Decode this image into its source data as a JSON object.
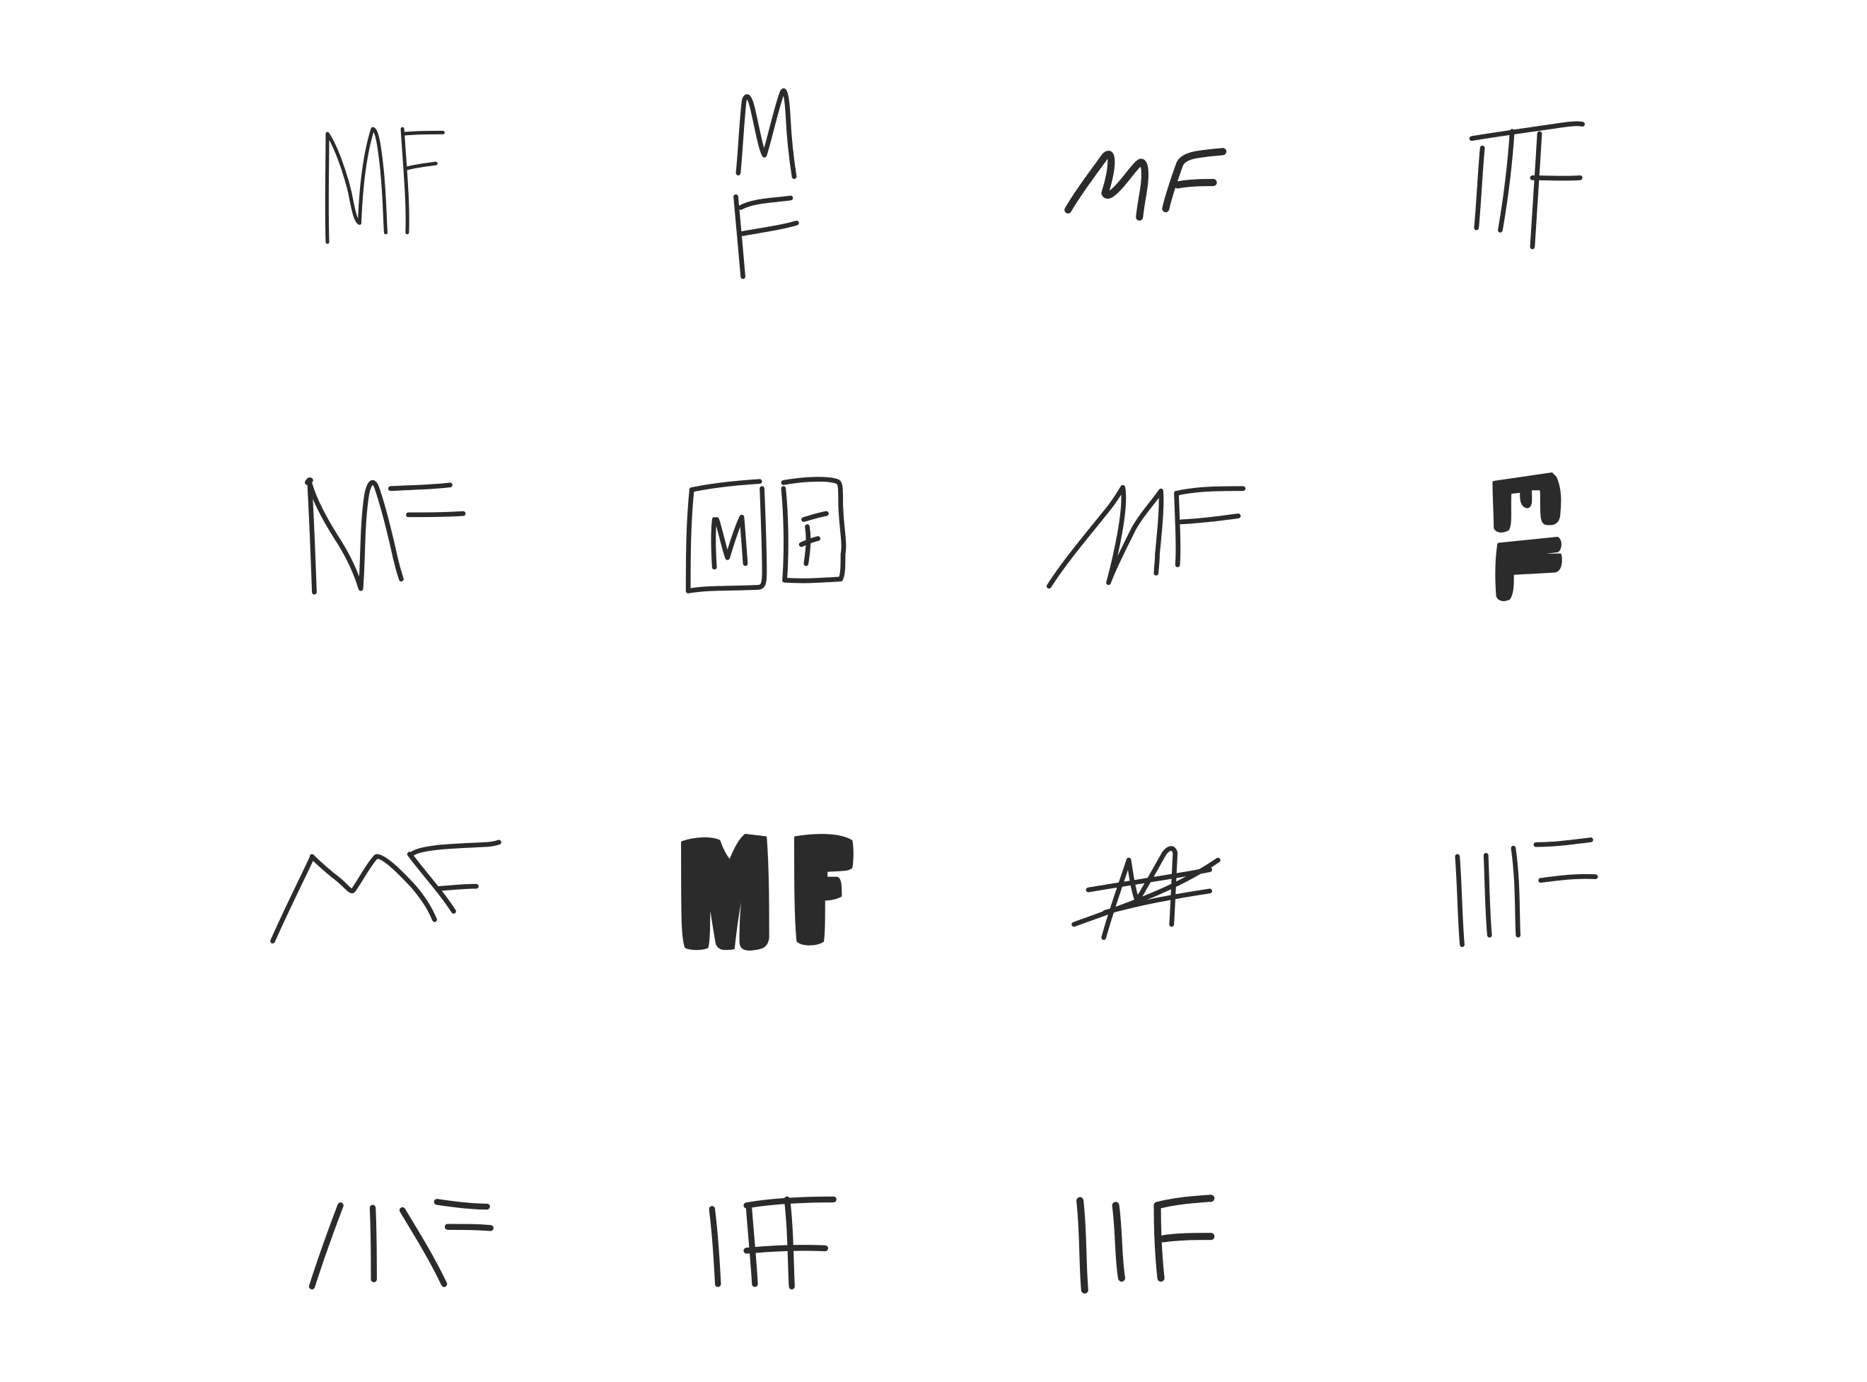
{
  "sheet": {
    "background": "#ffffff",
    "ink_color": "#2b2b2b",
    "sketches": [
      {
        "name": "sketch-mf-1",
        "style": "thin-outline"
      },
      {
        "name": "sketch-mf-2",
        "style": "stacked"
      },
      {
        "name": "sketch-mf-3",
        "style": "italic-bold"
      },
      {
        "name": "sketch-mf-4",
        "style": "pillars"
      },
      {
        "name": "sketch-mf-5",
        "style": "connected"
      },
      {
        "name": "sketch-mf-6",
        "style": "boxed"
      },
      {
        "name": "sketch-mf-7",
        "style": "slanted"
      },
      {
        "name": "sketch-mf-8",
        "style": "block-stacked"
      },
      {
        "name": "sketch-mf-9",
        "style": "mountain"
      },
      {
        "name": "sketch-mf-10",
        "style": "heavy-block"
      },
      {
        "name": "sketch-mf-11",
        "style": "crossed"
      },
      {
        "name": "sketch-mf-12",
        "style": "minimal-lines"
      },
      {
        "name": "sketch-mf-13",
        "style": "split-strokes"
      },
      {
        "name": "sketch-mf-14",
        "style": "merged-strokes"
      },
      {
        "name": "sketch-mf-15",
        "style": "bold-lines"
      }
    ]
  }
}
